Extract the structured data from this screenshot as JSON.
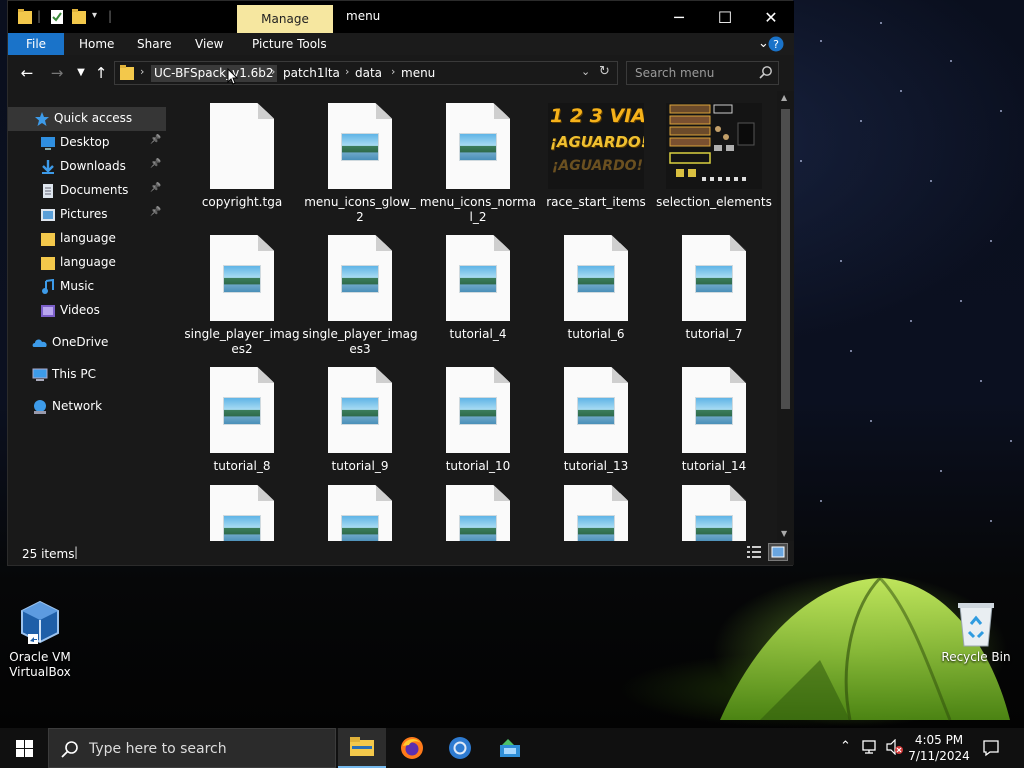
{
  "window": {
    "title": "menu",
    "contextual_tab": "Manage",
    "controls": {
      "minimize": "─",
      "maximize": "☐",
      "close": "✕"
    }
  },
  "ribbon": {
    "tabs": [
      "File",
      "Home",
      "Share",
      "View",
      "Picture Tools"
    ],
    "accent": "#1a73c9"
  },
  "address": {
    "crumbs": [
      "UC-BFSpack_v1.6b2",
      "patch1lta",
      "data",
      "menu"
    ]
  },
  "search": {
    "placeholder": "Search menu"
  },
  "sidebar": {
    "items": [
      {
        "label": "Quick access",
        "icon": "star-icon",
        "selected": true
      },
      {
        "label": "Desktop",
        "icon": "desktop-icon",
        "pinned": true
      },
      {
        "label": "Downloads",
        "icon": "download-icon",
        "pinned": true
      },
      {
        "label": "Documents",
        "icon": "documents-icon",
        "pinned": true
      },
      {
        "label": "Pictures",
        "icon": "pictures-icon",
        "pinned": true
      },
      {
        "label": "language",
        "icon": "folder-icon"
      },
      {
        "label": "language",
        "icon": "folder-icon"
      },
      {
        "label": "Music",
        "icon": "music-icon"
      },
      {
        "label": "Videos",
        "icon": "videos-icon"
      },
      {
        "label": "OneDrive",
        "icon": "onedrive-icon"
      },
      {
        "label": "This PC",
        "icon": "pc-icon"
      },
      {
        "label": "Network",
        "icon": "network-icon"
      }
    ]
  },
  "files": [
    {
      "name": "copyright.tga",
      "kind": "blank"
    },
    {
      "name": "menu_icons_glow_2",
      "kind": "image"
    },
    {
      "name": "menu_icons_normal_2",
      "kind": "image"
    },
    {
      "name": "race_start_items",
      "kind": "thumb-race",
      "thumb_text": [
        "1 2 3 VIA!",
        "¡AGUARDO!"
      ]
    },
    {
      "name": "selection_elements",
      "kind": "thumb-selection"
    },
    {
      "name": "single_player_images2",
      "kind": "image"
    },
    {
      "name": "single_player_images3",
      "kind": "image"
    },
    {
      "name": "tutorial_4",
      "kind": "image"
    },
    {
      "name": "tutorial_6",
      "kind": "image"
    },
    {
      "name": "tutorial_7",
      "kind": "image"
    },
    {
      "name": "tutorial_8",
      "kind": "image"
    },
    {
      "name": "tutorial_9",
      "kind": "image"
    },
    {
      "name": "tutorial_10",
      "kind": "image"
    },
    {
      "name": "tutorial_13",
      "kind": "image"
    },
    {
      "name": "tutorial_14",
      "kind": "image"
    },
    {
      "name": "",
      "kind": "image"
    },
    {
      "name": "",
      "kind": "image"
    },
    {
      "name": "",
      "kind": "image"
    },
    {
      "name": "",
      "kind": "image"
    },
    {
      "name": "",
      "kind": "image"
    }
  ],
  "status": {
    "item_count": "25 items"
  },
  "desktop": {
    "icons": [
      {
        "label": "Oracle VM VirtualBox",
        "icon": "virtualbox-icon"
      },
      {
        "label": "Recycle Bin",
        "icon": "recycle-bin-icon"
      }
    ]
  },
  "taskbar": {
    "search_placeholder": "Type here to search",
    "time": "4:05 PM",
    "date": "7/11/2024"
  }
}
